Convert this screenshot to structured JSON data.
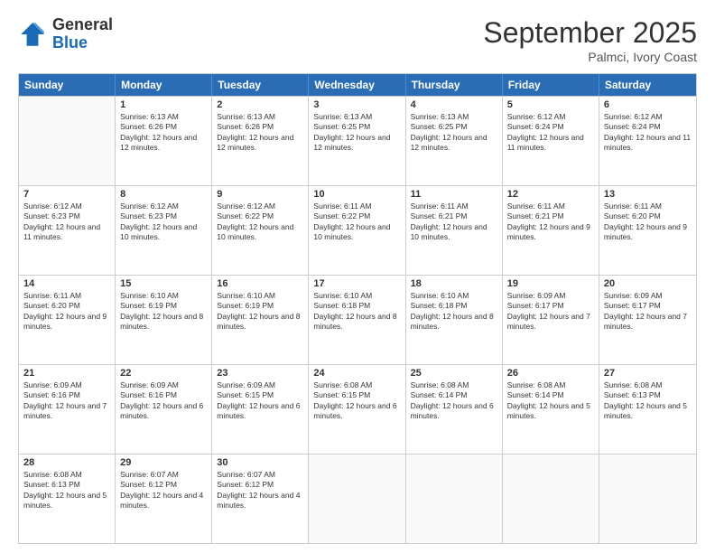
{
  "logo": {
    "general": "General",
    "blue": "Blue"
  },
  "title": "September 2025",
  "subtitle": "Palmci, Ivory Coast",
  "header_days": [
    "Sunday",
    "Monday",
    "Tuesday",
    "Wednesday",
    "Thursday",
    "Friday",
    "Saturday"
  ],
  "rows": [
    [
      {
        "day": "",
        "sunrise": "",
        "sunset": "",
        "daylight": "",
        "empty": true
      },
      {
        "day": "1",
        "sunrise": "Sunrise: 6:13 AM",
        "sunset": "Sunset: 6:26 PM",
        "daylight": "Daylight: 12 hours and 12 minutes."
      },
      {
        "day": "2",
        "sunrise": "Sunrise: 6:13 AM",
        "sunset": "Sunset: 6:26 PM",
        "daylight": "Daylight: 12 hours and 12 minutes."
      },
      {
        "day": "3",
        "sunrise": "Sunrise: 6:13 AM",
        "sunset": "Sunset: 6:25 PM",
        "daylight": "Daylight: 12 hours and 12 minutes."
      },
      {
        "day": "4",
        "sunrise": "Sunrise: 6:13 AM",
        "sunset": "Sunset: 6:25 PM",
        "daylight": "Daylight: 12 hours and 12 minutes."
      },
      {
        "day": "5",
        "sunrise": "Sunrise: 6:12 AM",
        "sunset": "Sunset: 6:24 PM",
        "daylight": "Daylight: 12 hours and 11 minutes."
      },
      {
        "day": "6",
        "sunrise": "Sunrise: 6:12 AM",
        "sunset": "Sunset: 6:24 PM",
        "daylight": "Daylight: 12 hours and 11 minutes."
      }
    ],
    [
      {
        "day": "7",
        "sunrise": "Sunrise: 6:12 AM",
        "sunset": "Sunset: 6:23 PM",
        "daylight": "Daylight: 12 hours and 11 minutes."
      },
      {
        "day": "8",
        "sunrise": "Sunrise: 6:12 AM",
        "sunset": "Sunset: 6:23 PM",
        "daylight": "Daylight: 12 hours and 10 minutes."
      },
      {
        "day": "9",
        "sunrise": "Sunrise: 6:12 AM",
        "sunset": "Sunset: 6:22 PM",
        "daylight": "Daylight: 12 hours and 10 minutes."
      },
      {
        "day": "10",
        "sunrise": "Sunrise: 6:11 AM",
        "sunset": "Sunset: 6:22 PM",
        "daylight": "Daylight: 12 hours and 10 minutes."
      },
      {
        "day": "11",
        "sunrise": "Sunrise: 6:11 AM",
        "sunset": "Sunset: 6:21 PM",
        "daylight": "Daylight: 12 hours and 10 minutes."
      },
      {
        "day": "12",
        "sunrise": "Sunrise: 6:11 AM",
        "sunset": "Sunset: 6:21 PM",
        "daylight": "Daylight: 12 hours and 9 minutes."
      },
      {
        "day": "13",
        "sunrise": "Sunrise: 6:11 AM",
        "sunset": "Sunset: 6:20 PM",
        "daylight": "Daylight: 12 hours and 9 minutes."
      }
    ],
    [
      {
        "day": "14",
        "sunrise": "Sunrise: 6:11 AM",
        "sunset": "Sunset: 6:20 PM",
        "daylight": "Daylight: 12 hours and 9 minutes."
      },
      {
        "day": "15",
        "sunrise": "Sunrise: 6:10 AM",
        "sunset": "Sunset: 6:19 PM",
        "daylight": "Daylight: 12 hours and 8 minutes."
      },
      {
        "day": "16",
        "sunrise": "Sunrise: 6:10 AM",
        "sunset": "Sunset: 6:19 PM",
        "daylight": "Daylight: 12 hours and 8 minutes."
      },
      {
        "day": "17",
        "sunrise": "Sunrise: 6:10 AM",
        "sunset": "Sunset: 6:18 PM",
        "daylight": "Daylight: 12 hours and 8 minutes."
      },
      {
        "day": "18",
        "sunrise": "Sunrise: 6:10 AM",
        "sunset": "Sunset: 6:18 PM",
        "daylight": "Daylight: 12 hours and 8 minutes."
      },
      {
        "day": "19",
        "sunrise": "Sunrise: 6:09 AM",
        "sunset": "Sunset: 6:17 PM",
        "daylight": "Daylight: 12 hours and 7 minutes."
      },
      {
        "day": "20",
        "sunrise": "Sunrise: 6:09 AM",
        "sunset": "Sunset: 6:17 PM",
        "daylight": "Daylight: 12 hours and 7 minutes."
      }
    ],
    [
      {
        "day": "21",
        "sunrise": "Sunrise: 6:09 AM",
        "sunset": "Sunset: 6:16 PM",
        "daylight": "Daylight: 12 hours and 7 minutes."
      },
      {
        "day": "22",
        "sunrise": "Sunrise: 6:09 AM",
        "sunset": "Sunset: 6:16 PM",
        "daylight": "Daylight: 12 hours and 6 minutes."
      },
      {
        "day": "23",
        "sunrise": "Sunrise: 6:09 AM",
        "sunset": "Sunset: 6:15 PM",
        "daylight": "Daylight: 12 hours and 6 minutes."
      },
      {
        "day": "24",
        "sunrise": "Sunrise: 6:08 AM",
        "sunset": "Sunset: 6:15 PM",
        "daylight": "Daylight: 12 hours and 6 minutes."
      },
      {
        "day": "25",
        "sunrise": "Sunrise: 6:08 AM",
        "sunset": "Sunset: 6:14 PM",
        "daylight": "Daylight: 12 hours and 6 minutes."
      },
      {
        "day": "26",
        "sunrise": "Sunrise: 6:08 AM",
        "sunset": "Sunset: 6:14 PM",
        "daylight": "Daylight: 12 hours and 5 minutes."
      },
      {
        "day": "27",
        "sunrise": "Sunrise: 6:08 AM",
        "sunset": "Sunset: 6:13 PM",
        "daylight": "Daylight: 12 hours and 5 minutes."
      }
    ],
    [
      {
        "day": "28",
        "sunrise": "Sunrise: 6:08 AM",
        "sunset": "Sunset: 6:13 PM",
        "daylight": "Daylight: 12 hours and 5 minutes."
      },
      {
        "day": "29",
        "sunrise": "Sunrise: 6:07 AM",
        "sunset": "Sunset: 6:12 PM",
        "daylight": "Daylight: 12 hours and 4 minutes."
      },
      {
        "day": "30",
        "sunrise": "Sunrise: 6:07 AM",
        "sunset": "Sunset: 6:12 PM",
        "daylight": "Daylight: 12 hours and 4 minutes."
      },
      {
        "day": "",
        "sunrise": "",
        "sunset": "",
        "daylight": "",
        "empty": true
      },
      {
        "day": "",
        "sunrise": "",
        "sunset": "",
        "daylight": "",
        "empty": true
      },
      {
        "day": "",
        "sunrise": "",
        "sunset": "",
        "daylight": "",
        "empty": true
      },
      {
        "day": "",
        "sunrise": "",
        "sunset": "",
        "daylight": "",
        "empty": true
      }
    ]
  ]
}
